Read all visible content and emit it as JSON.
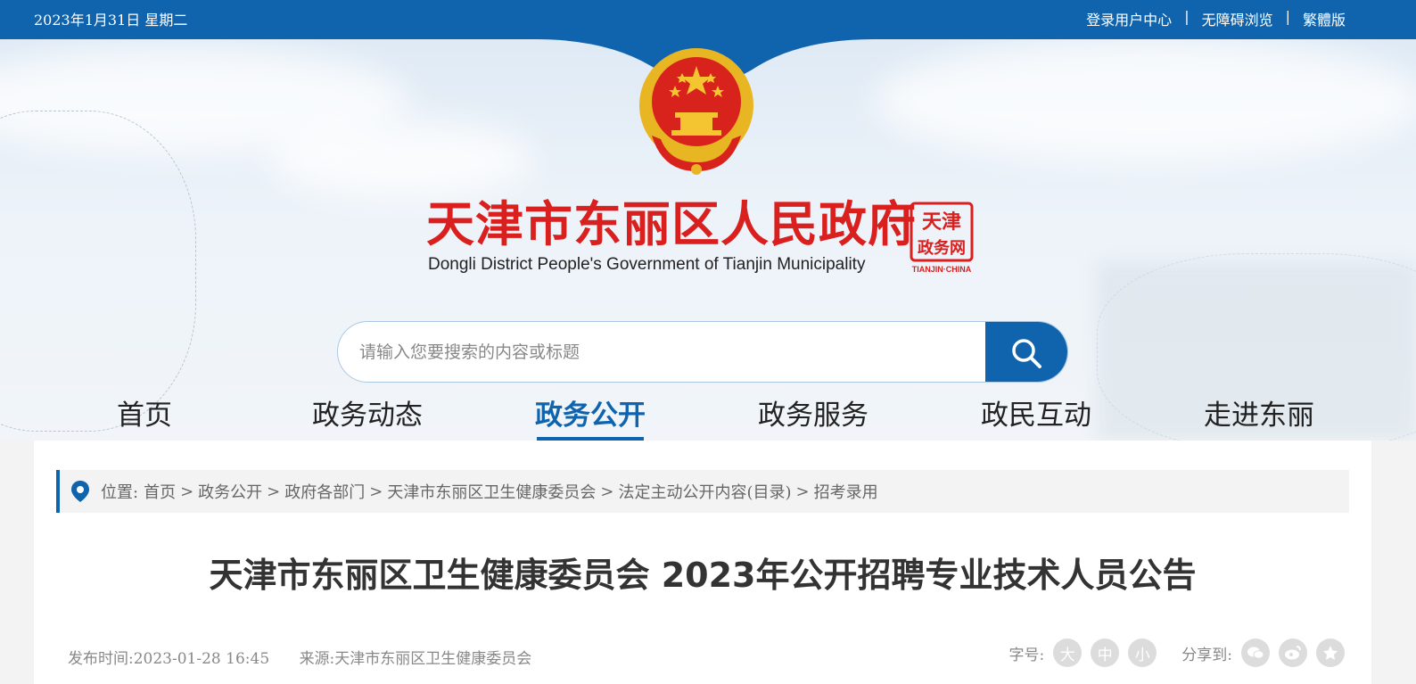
{
  "topbar": {
    "date": "2023年1月31日 星期二",
    "links": [
      "登录用户中心",
      "无障碍浏览",
      "繁體版"
    ],
    "separator": "|"
  },
  "site": {
    "title": "天津市东丽区人民政府",
    "subtitle": "Dongli District People's Government of Tianjin Municipality",
    "seal_text": "天津政务网",
    "seal_caption": "TIANJIN·CHINA"
  },
  "search": {
    "placeholder": "请输入您要搜索的内容或标题",
    "icon": "search-icon"
  },
  "nav": {
    "items": [
      "首页",
      "政务动态",
      "政务公开",
      "政务服务",
      "政民互动",
      "走进东丽"
    ],
    "active": "政务公开"
  },
  "breadcrumb": {
    "label": "位置:",
    "items": [
      "首页",
      "政务公开",
      "政府各部门",
      "天津市东丽区卫生健康委员会",
      "法定主动公开内容(目录)",
      "招考录用"
    ],
    "separator": ">"
  },
  "article": {
    "title": "天津市东丽区卫生健康委员会 2023年公开招聘专业技术人员公告",
    "published_label": "发布时间:",
    "published": "2023-01-28 16:45",
    "source_label": "来源:",
    "source": "天津市东丽区卫生健康委员会"
  },
  "tools": {
    "font_size_label": "字号:",
    "font_sizes": [
      "大",
      "中",
      "小"
    ],
    "share_label": "分享到:",
    "share_icons": [
      "wechat-icon",
      "weibo-icon",
      "favorite-icon"
    ]
  },
  "colors": {
    "brand_blue": "#0f64ad",
    "title_red": "#d9201f"
  }
}
